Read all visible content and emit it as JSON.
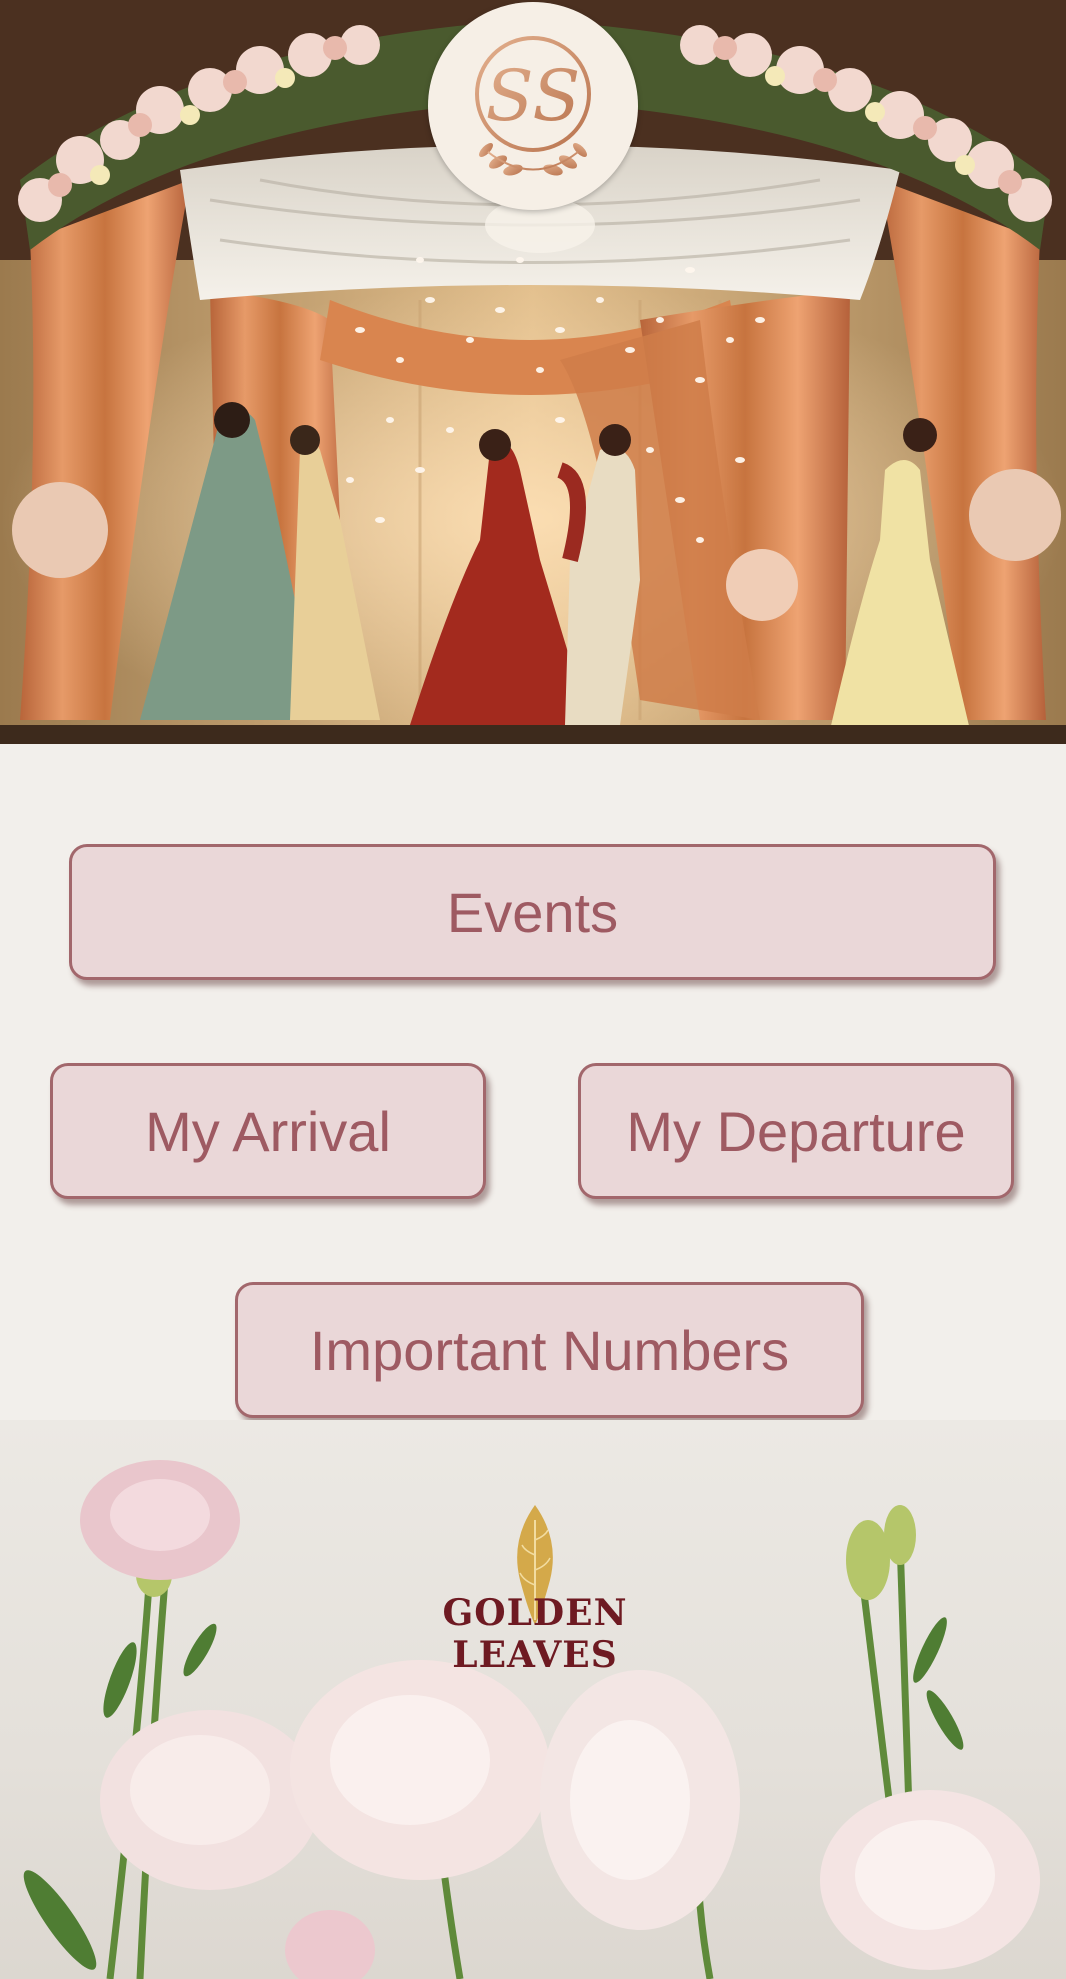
{
  "hero": {
    "photo_subject": "wedding-mandap-photo",
    "monogram_letters": "SS"
  },
  "menu": {
    "events_label": "Events",
    "arrival_label": "My Arrival",
    "departure_label": "My Departure",
    "numbers_label": "Important Numbers"
  },
  "footer": {
    "brand_name": "GOLDEN LEAVES",
    "brand_icon": "golden-leaf-icon"
  },
  "colors": {
    "button_fill": "#ead7d8",
    "button_border": "#a2676c",
    "button_text": "#9e5a62",
    "page_background": "#f2efeb",
    "brand_text": "#6e1a22",
    "brand_gold": "#d4a94a"
  }
}
